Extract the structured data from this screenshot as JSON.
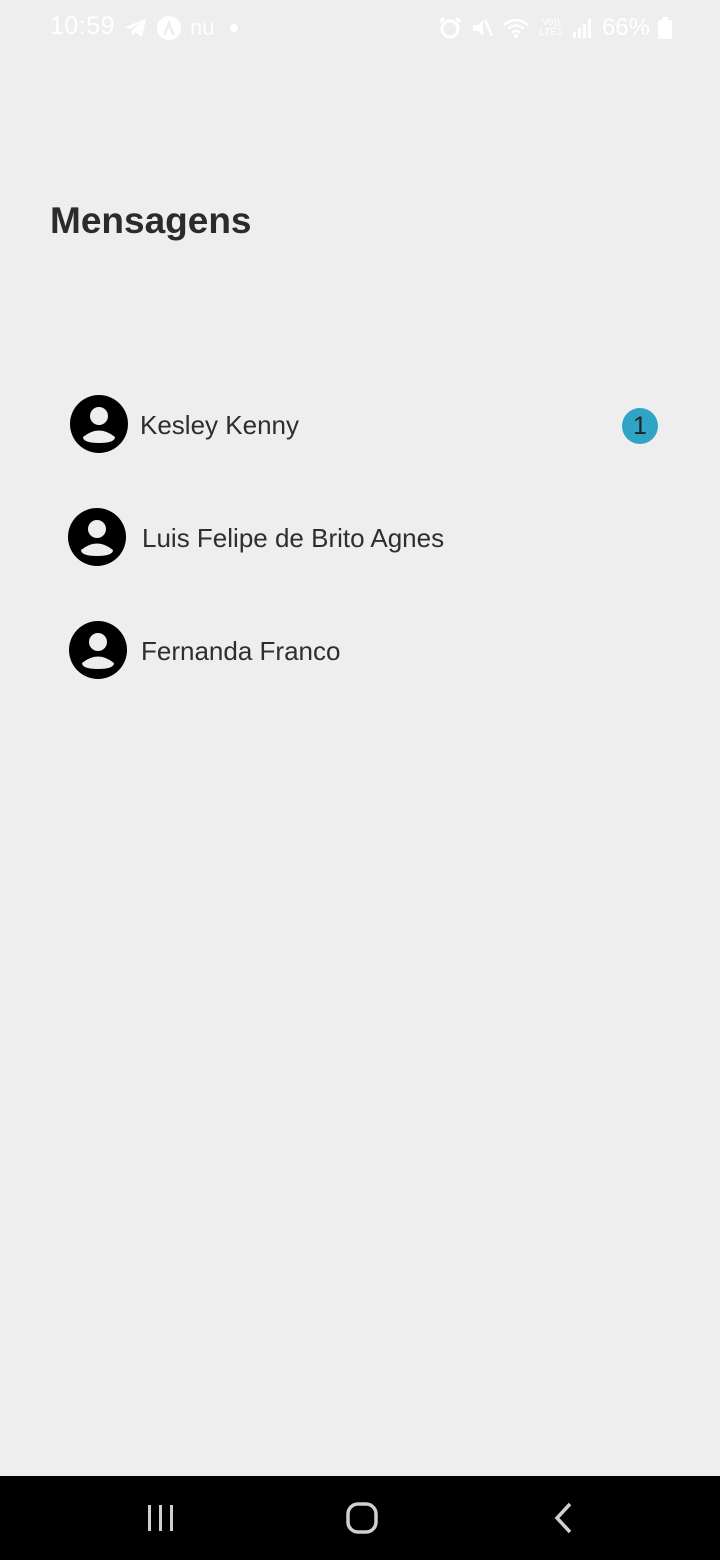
{
  "status_bar": {
    "time": "10:59",
    "app_label": "nu",
    "battery": "66%",
    "volte": "Vo)) LTE1"
  },
  "page": {
    "title": "Mensagens"
  },
  "contacts": [
    {
      "name": "Kesley Kenny",
      "unread": "1"
    },
    {
      "name": "Luis Felipe de Brito Agnes",
      "unread": ""
    },
    {
      "name": "Fernanda Franco",
      "unread": ""
    }
  ],
  "colors": {
    "background": "#eeeeee",
    "badge": "#2fa4c4",
    "text": "#2e2e2e"
  },
  "icons": {
    "avatar": "user-avatar-icon",
    "nav_recents": "recents-icon",
    "nav_home": "home-icon",
    "nav_back": "back-icon"
  }
}
